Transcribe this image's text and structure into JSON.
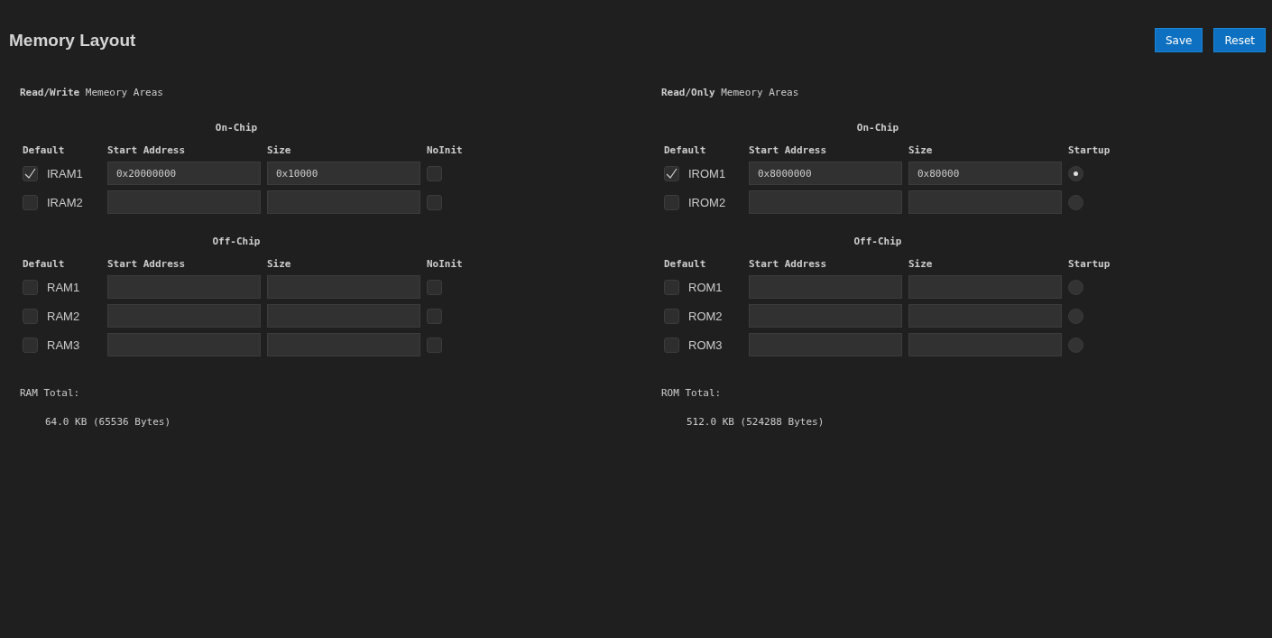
{
  "title": "Memory Layout",
  "buttons": [
    "Save",
    "Reset"
  ],
  "panels": [
    {
      "heading": "**Read/Write** Memeory Areas",
      "kind": "checkbox",
      "sections": [
        {
          "title": "On-Chip",
          "headers": [
            "Default",
            "Start Address",
            "Size",
            "NoInit"
          ],
          "rows": [
            {
              "label": "IRAM1",
              "checked": true,
              "start": "0x20000000",
              "size": "0x10000",
              "extra": false
            },
            {
              "label": "IRAM2",
              "checked": false,
              "extra": false
            }
          ]
        },
        {
          "title": "Off-Chip",
          "headers": [
            "Default",
            "Start Address",
            "Size",
            "NoInit"
          ],
          "rows": [
            {
              "label": "RAM1",
              "checked": false,
              "extra": false
            },
            {
              "label": "RAM2",
              "checked": false,
              "extra": false
            },
            {
              "label": "RAM3",
              "checked": false,
              "extra": false
            }
          ]
        }
      ],
      "total_label": "RAM Total:",
      "total_value": "64.0 KB (65536 Bytes)"
    },
    {
      "heading": "**Read/Only** Memeory Areas",
      "kind": "radio",
      "sections": [
        {
          "title": "On-Chip",
          "headers": [
            "Default",
            "Start Address",
            "Size",
            "Startup"
          ],
          "rows": [
            {
              "label": "IROM1",
              "checked": true,
              "start": "0x8000000",
              "size": "0x80000",
              "extra": true
            },
            {
              "label": "IROM2",
              "checked": false,
              "extra": false
            }
          ]
        },
        {
          "title": "Off-Chip",
          "headers": [
            "Default",
            "Start Address",
            "Size",
            "Startup"
          ],
          "rows": [
            {
              "label": "ROM1",
              "checked": false,
              "extra": false
            },
            {
              "label": "ROM2",
              "checked": false,
              "extra": false
            },
            {
              "label": "ROM3",
              "checked": false,
              "extra": false
            }
          ]
        }
      ],
      "total_label": "ROM Total:",
      "total_value": "512.0 KB (524288 Bytes)"
    }
  ]
}
